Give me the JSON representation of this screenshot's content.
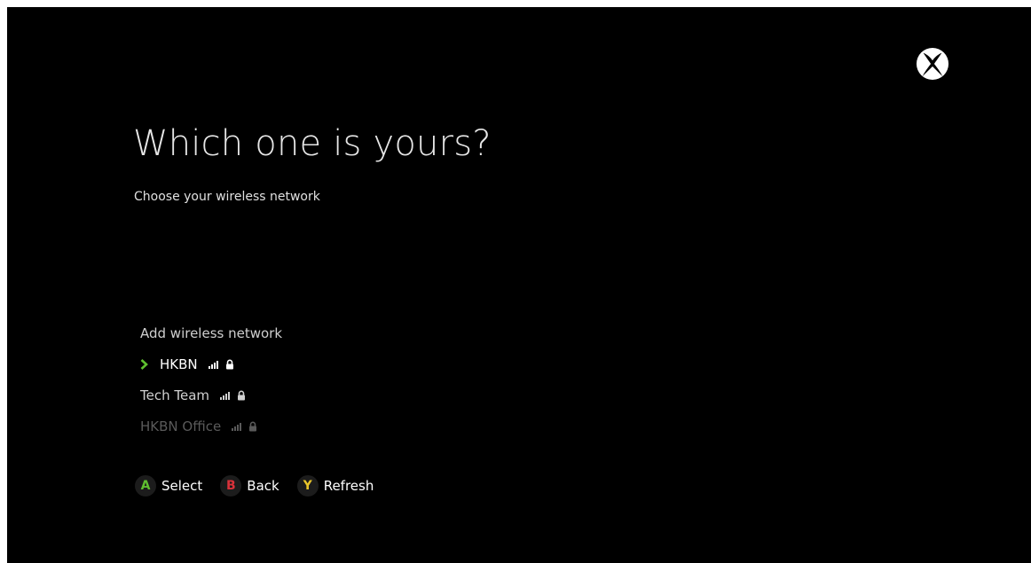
{
  "header": {
    "title": "Which one is yours?",
    "subtitle": "Choose your wireless network",
    "logo_icon": "xbox-logo-icon"
  },
  "networks": {
    "add_label": "Add wireless network",
    "items": [
      {
        "name": "HKBN",
        "selected": true,
        "secured": true,
        "signal": "strong"
      },
      {
        "name": "Tech Team",
        "selected": false,
        "secured": true,
        "signal": "strong"
      },
      {
        "name": "HKBN Office",
        "selected": false,
        "secured": true,
        "signal": "weak"
      }
    ]
  },
  "controls": [
    {
      "key": "A",
      "label": "Select",
      "color": "#5fbf2f"
    },
    {
      "key": "B",
      "label": "Back",
      "color": "#d9323a"
    },
    {
      "key": "Y",
      "label": "Refresh",
      "color": "#e8c52a"
    }
  ],
  "colors": {
    "background": "#000000",
    "accent": "#5fbf2f"
  }
}
